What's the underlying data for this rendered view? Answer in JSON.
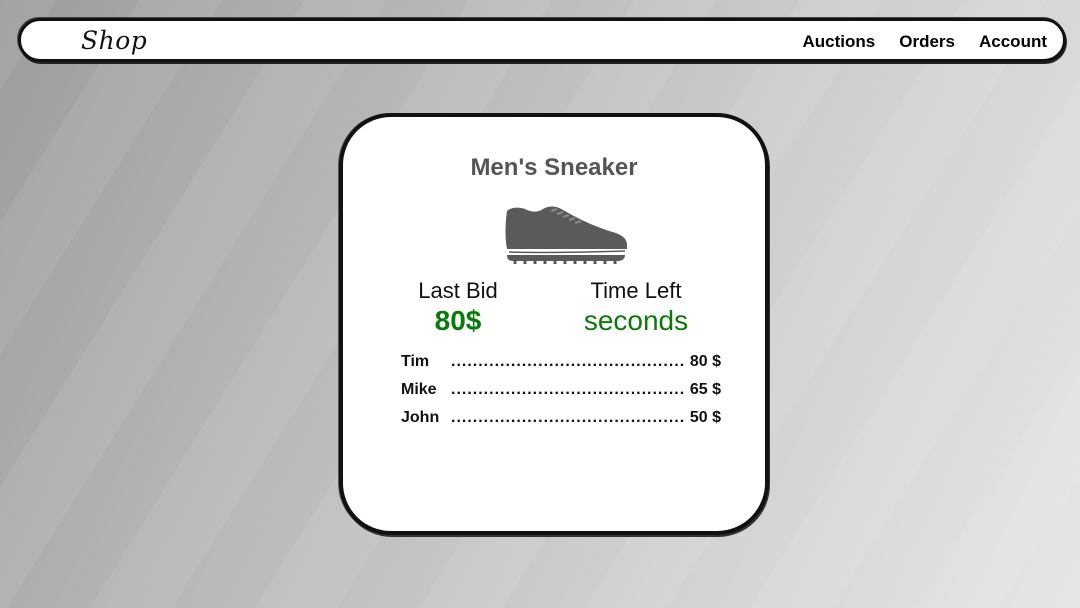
{
  "nav": {
    "logo": "Shop",
    "links": [
      "Auctions",
      "Orders",
      "Account"
    ]
  },
  "auction": {
    "title": "Men's Sneaker",
    "image_icon": "sneaker-icon",
    "last_bid_label": "Last Bid",
    "last_bid_value": "80$",
    "time_left_label": "Time Left",
    "time_left_value": "seconds",
    "bids": [
      {
        "name": "Tim",
        "amount": "80 $"
      },
      {
        "name": "Mike",
        "amount": "65 $"
      },
      {
        "name": "John",
        "amount": "50 $"
      }
    ]
  },
  "colors": {
    "accent_green": "#0a7a0a",
    "title_gray": "#555555",
    "sneaker_gray": "#5a5a5a"
  }
}
